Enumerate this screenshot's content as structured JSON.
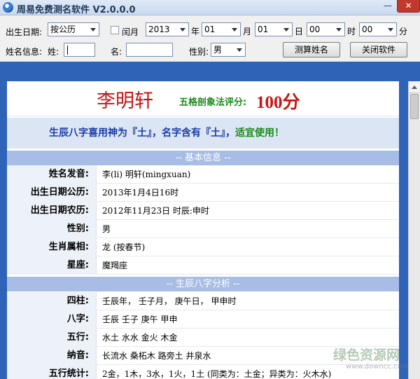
{
  "window": {
    "title": "周易免费测名软件 V2.0.0.0",
    "minimize_glyph": "—",
    "close_glyph": "✕"
  },
  "toolbar": {
    "birth_label": "出生日期:",
    "calendar_value": "按公历",
    "leap_label": "闰月",
    "year_value": "2013",
    "year_unit": "年",
    "month_value": "01",
    "month_unit": "月",
    "day_value": "01",
    "day_unit": "日",
    "hour_value": "00",
    "hour_unit": "时",
    "minute_value": "00",
    "minute_unit": "分",
    "name_info_label": "姓名信息:",
    "surname_label": "姓:",
    "given_label": "名:",
    "gender_label": "性别:",
    "gender_value": "男",
    "calc_button": "测算姓名",
    "close_button": "关闭软件"
  },
  "result": {
    "name": "李明轩",
    "score_label": "五格剖象法评分:",
    "score_value": "100分",
    "bazi_text": "生辰八字喜用神为『土』，名字含有『土』，",
    "bazi_verdict": "适宜使用！",
    "section_basic": "-- 基本信息 --",
    "basic": [
      {
        "label": "姓名发音:",
        "value": "李(li) 明轩(mingxuan)"
      },
      {
        "label": "出生日期公历:",
        "value": "2013年1月4日16时"
      },
      {
        "label": "出生日期农历:",
        "value": "2012年11月23日 时辰:申时"
      },
      {
        "label": "性别:",
        "value": "男"
      },
      {
        "label": "生肖属相:",
        "value": "龙 (按春节)"
      },
      {
        "label": "星座:",
        "value": "魔羯座"
      }
    ],
    "section_bazi": "-- 生辰八字分析 --",
    "bazi": [
      {
        "label": "四柱:",
        "value": "壬辰年，  壬子月，  庚午日，  甲申时"
      },
      {
        "label": "八字:",
        "value": "壬辰  壬子  庚午  甲申"
      },
      {
        "label": "五行:",
        "value": "水土  水水  金火  木金"
      },
      {
        "label": "纳音:",
        "value": "长流水  桑柘木  路旁土  井泉水"
      },
      {
        "label": "五行统计:",
        "value": "2金，1木，3水，1火，1土 (同类为：土金；异类为：火木水)"
      }
    ]
  },
  "watermark": {
    "cn": "绿色资源网",
    "en": "www.downcc.com"
  },
  "colors": {
    "accent_red": "#c81414",
    "accent_green": "#1b8a1b",
    "accent_blue": "#1a3ea8",
    "section_header": "#a7bde5",
    "background_blue": "#2e63b8"
  }
}
